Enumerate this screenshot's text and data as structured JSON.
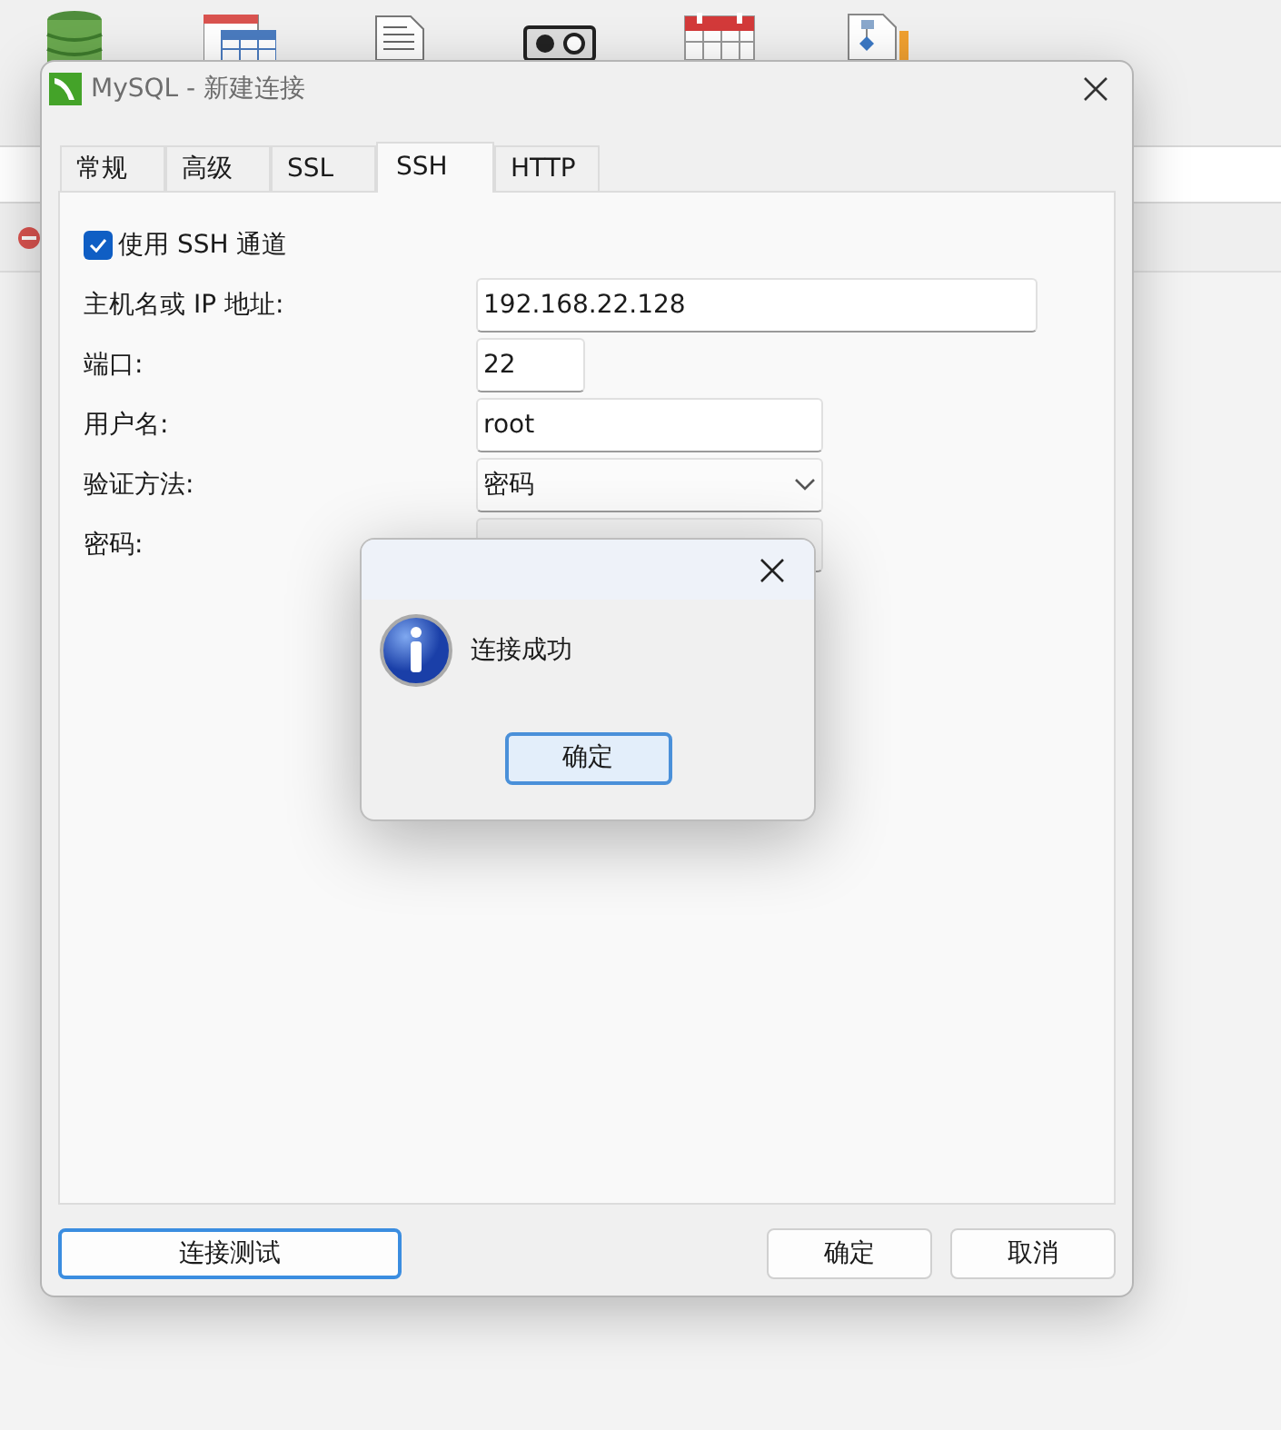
{
  "dialog": {
    "title": "MySQL - 新建连接",
    "tabs": [
      {
        "label": "常规",
        "selected": false
      },
      {
        "label": "高级",
        "selected": false
      },
      {
        "label": "SSL",
        "selected": false
      },
      {
        "label": "SSH",
        "selected": true
      },
      {
        "label": "HTTP",
        "selected": false
      }
    ],
    "ssh_tunnel": {
      "label": "使用 SSH 通道",
      "checked": true
    },
    "fields": [
      {
        "label": "主机名或 IP 地址:",
        "kind": "input",
        "value": "192.168.22.128"
      },
      {
        "label": "端口:",
        "kind": "input",
        "value": "22"
      },
      {
        "label": "用户名:",
        "kind": "input",
        "value": "root"
      },
      {
        "label": "验证方法:",
        "kind": "select",
        "value": "密码"
      },
      {
        "label": "密码:",
        "kind": "password"
      }
    ],
    "buttons": [
      {
        "label": "连接测试",
        "focused": true
      },
      {
        "label": "确定",
        "focused": false
      },
      {
        "label": "取消",
        "focused": false
      }
    ]
  },
  "message_box": {
    "message": "连接成功",
    "button": {
      "label": "确定",
      "focused": true
    }
  }
}
